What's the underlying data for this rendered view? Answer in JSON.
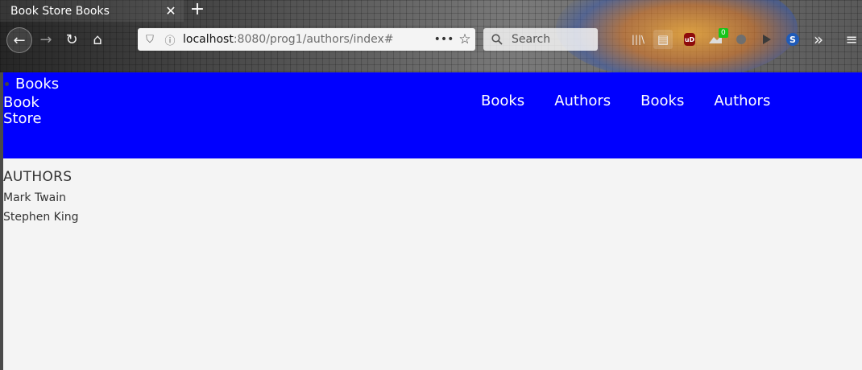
{
  "browser": {
    "tab_title": "Book Store Books",
    "tab_close_symbol": "✕",
    "new_tab_symbol": "+",
    "url_host": "localhost",
    "url_rest": ":8080/prog1/authors/index#",
    "search_placeholder": "Search",
    "badge_count": "0",
    "icons": {
      "back": "←",
      "forward": "→",
      "reload": "↻",
      "home": "⌂",
      "shield": "⛉",
      "info": "ⓘ",
      "more": "•••",
      "star": "☆",
      "search": "⚲",
      "library": "|||\\",
      "reader": "▤",
      "ublock": "uD",
      "s": "S",
      "overflow": "»",
      "menu": "≡"
    }
  },
  "site": {
    "bullet_link": "Books",
    "brand": "Book Store",
    "nav": [
      "Books",
      "Authors",
      "Books",
      "Authors"
    ],
    "colors": {
      "header_bg": "#0000ff",
      "header_text": "#ffffff",
      "page_bg": "#f4f4f4"
    }
  },
  "main": {
    "heading": "AUTHORS",
    "authors": [
      "Mark Twain",
      "Stephen King"
    ]
  }
}
